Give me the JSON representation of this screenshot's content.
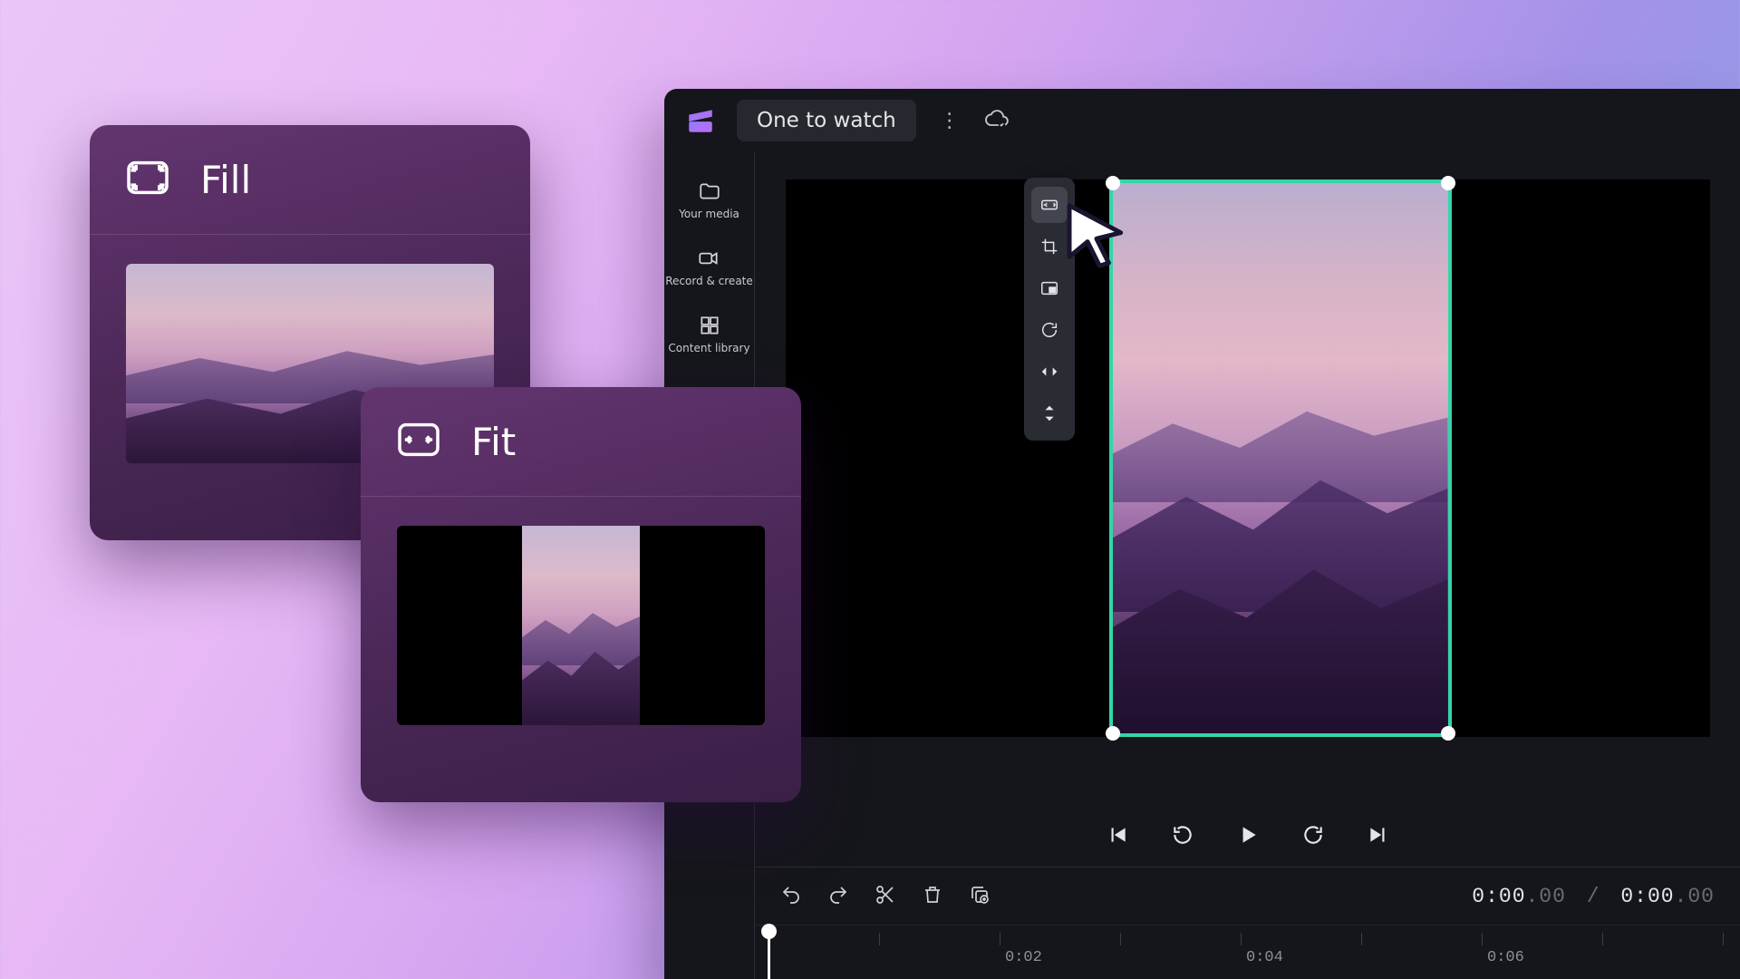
{
  "header": {
    "project_name": "One to watch"
  },
  "sidebar": {
    "items": [
      {
        "label": "Your media"
      },
      {
        "label": "Record & create"
      },
      {
        "label": "Content library"
      }
    ]
  },
  "floating_tools": [
    "fit-fill",
    "crop",
    "pip",
    "rotate",
    "flip-horizontal",
    "flip-vertical"
  ],
  "transport": {
    "current": "0:00",
    "current_ms": ".00",
    "total": "0:00",
    "total_ms": ".00"
  },
  "ruler_labels": [
    "0:02",
    "0:04",
    "0:06"
  ],
  "cards": {
    "fill": {
      "title": "Fill"
    },
    "fit": {
      "title": "Fit"
    }
  }
}
